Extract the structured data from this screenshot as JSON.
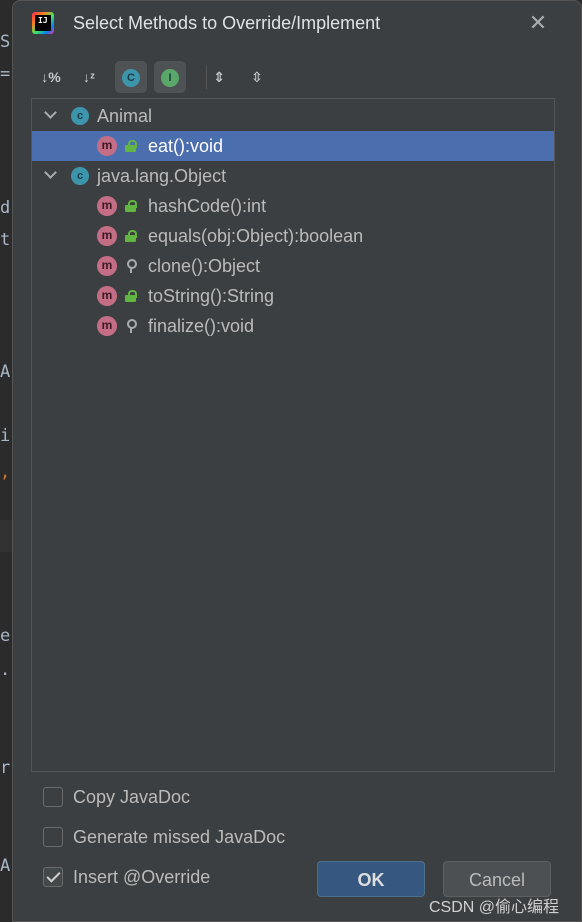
{
  "editor_bg": {
    "glyphs": [
      "S",
      "=",
      "d",
      "t",
      "A",
      "i",
      ",",
      "e",
      ".",
      "r",
      "A"
    ]
  },
  "dialog": {
    "title": "Select Methods to Override/Implement",
    "close_glyph": "✕",
    "app_icon_text": "IJ"
  },
  "toolbar": {
    "sort_by_percent_glyph": "↓%",
    "sort_alpha_glyph": "↓ᶻ",
    "show_classes_glyph": "C",
    "show_interfaces_glyph": "I",
    "expand_all_glyph": "⇕",
    "collapse_all_glyph": "⇳"
  },
  "tree": {
    "groups": [
      {
        "name": "Animal",
        "icon": "class-icon",
        "methods": [
          {
            "label": "eat():void",
            "visibility": "public",
            "selected": true
          }
        ]
      },
      {
        "name": "java.lang.Object",
        "icon": "class-icon",
        "methods": [
          {
            "label": "hashCode():int",
            "visibility": "public"
          },
          {
            "label": "equals(obj:Object):boolean",
            "visibility": "public"
          },
          {
            "label": "clone():Object",
            "visibility": "protected"
          },
          {
            "label": "toString():String",
            "visibility": "public"
          },
          {
            "label": "finalize():void",
            "visibility": "protected"
          }
        ]
      }
    ],
    "class_icon_letter": "c",
    "method_icon_letter": "m"
  },
  "options": {
    "copy_javadoc": {
      "label": "Copy JavaDoc",
      "checked": false
    },
    "generate_javadoc": {
      "label": "Generate missed JavaDoc",
      "checked": false
    },
    "insert_override": {
      "label": "Insert @Override",
      "checked": true
    }
  },
  "buttons": {
    "ok": "OK",
    "cancel": "Cancel"
  },
  "watermark": "CSDN @偷心编程",
  "colors": {
    "selection": "#4b6eaf",
    "dialog_bg": "#3c3f41",
    "ok_button": "#365880",
    "class_icon": "#3d95ab",
    "method_icon": "#c46e86",
    "public_icon": "#62b543"
  }
}
